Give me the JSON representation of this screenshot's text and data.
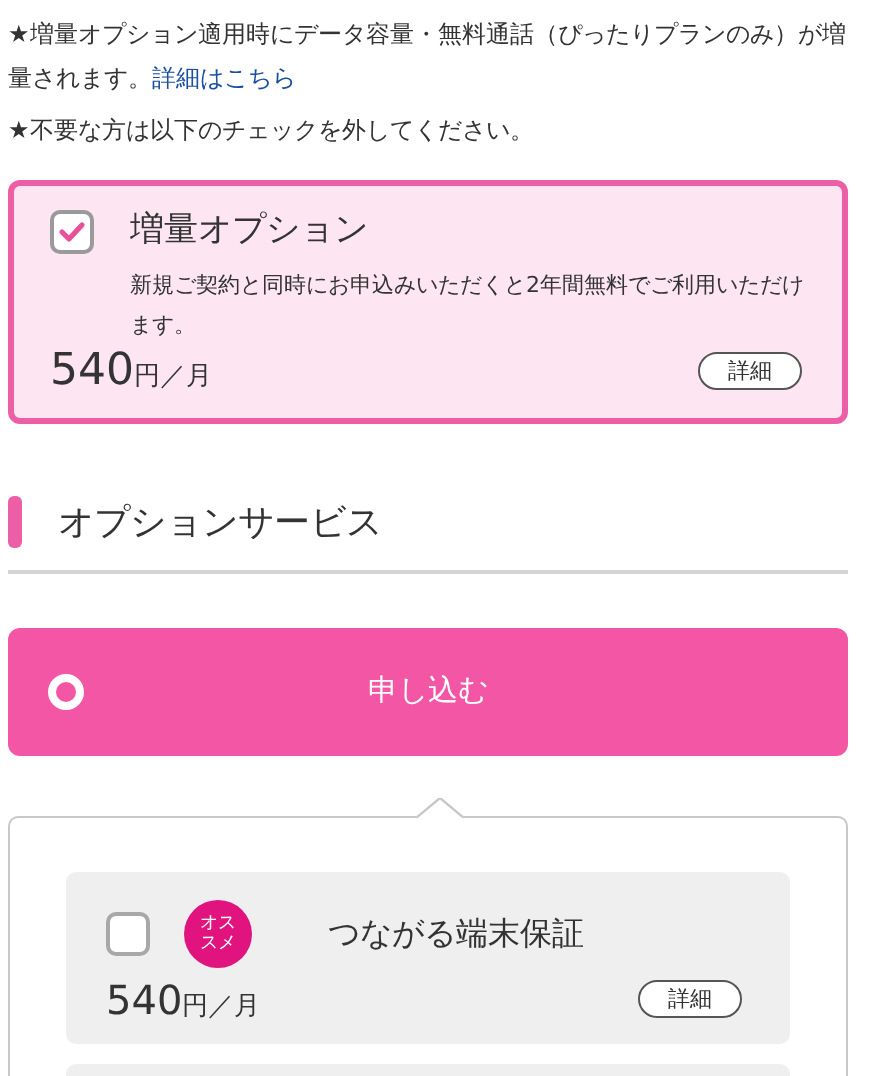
{
  "notes": [
    {
      "text": "★増量オプション適用時にデータ容量・無料通話（ぴったりプランのみ）が増量されます。",
      "link": "詳細はこちら"
    },
    {
      "text": "★不要な方は以下のチェックを外してください。"
    }
  ],
  "featured_option": {
    "title": "増量オプション",
    "checked": true,
    "description": "新規ご契約と同時にお申込みいただくと2年間無料でご利用いただけます。",
    "price": "540",
    "unit": "円／月",
    "detail_button": "詳細"
  },
  "section": {
    "title": "オプションサービス"
  },
  "apply_button": {
    "label": "申し込む"
  },
  "options": [
    {
      "title": "つながる端末保証",
      "checked": false,
      "badge": "オススメ",
      "price": "540",
      "unit": "円／月",
      "detail_button": "詳細"
    }
  ]
}
